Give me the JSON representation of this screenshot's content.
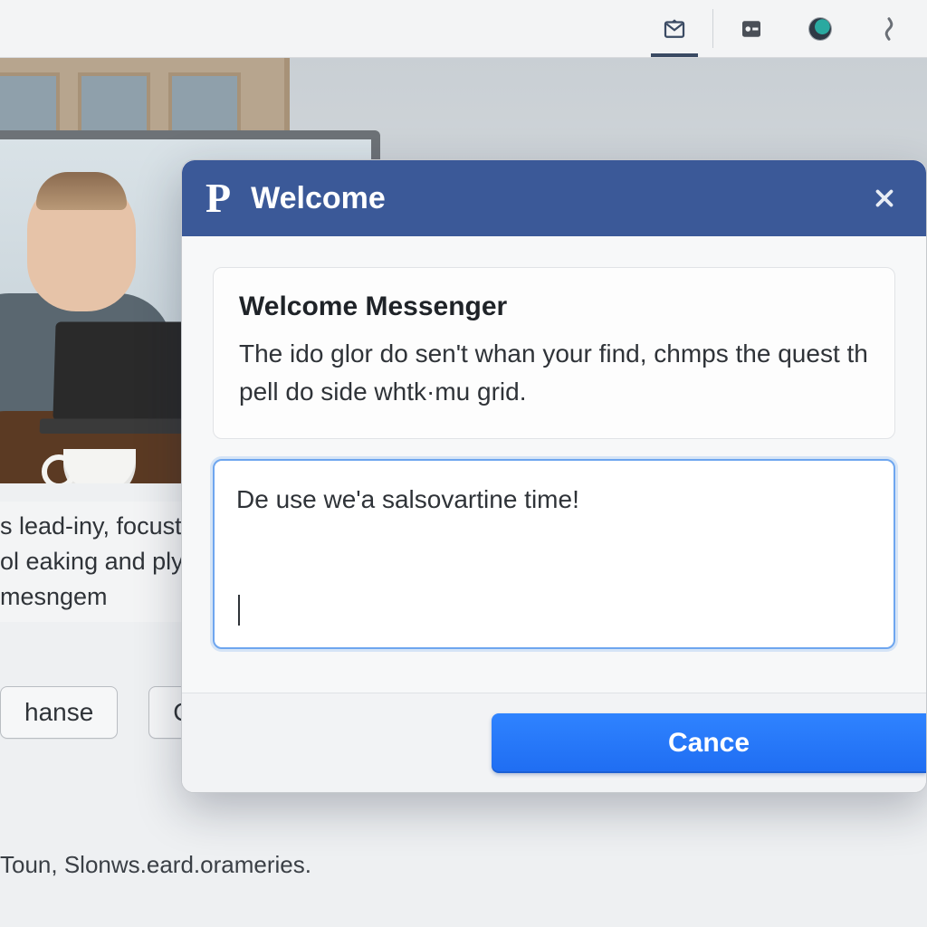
{
  "toolbar": {
    "items": [
      {
        "name": "mail-icon",
        "active": true
      },
      {
        "name": "speaker-icon",
        "active": false
      },
      {
        "name": "avatar",
        "active": false
      },
      {
        "name": "bolt-icon",
        "active": false
      }
    ]
  },
  "background": {
    "blurb": "s lead-iny, focust ol eaking and ply mesngem",
    "buttons": {
      "hanse": "hanse",
      "ca": "Ca"
    },
    "footer": "Toun, Slonws.eard.orameries."
  },
  "dialog": {
    "logo": "P",
    "title": "Welcome",
    "heading": "Welcome Messenger",
    "description": "The ido glor do sen't whan your find, chmps the quest th pell do side whtk·mu grid.",
    "textarea_value": "De use we'a salsovartine time!",
    "primary_label": "Cance"
  }
}
